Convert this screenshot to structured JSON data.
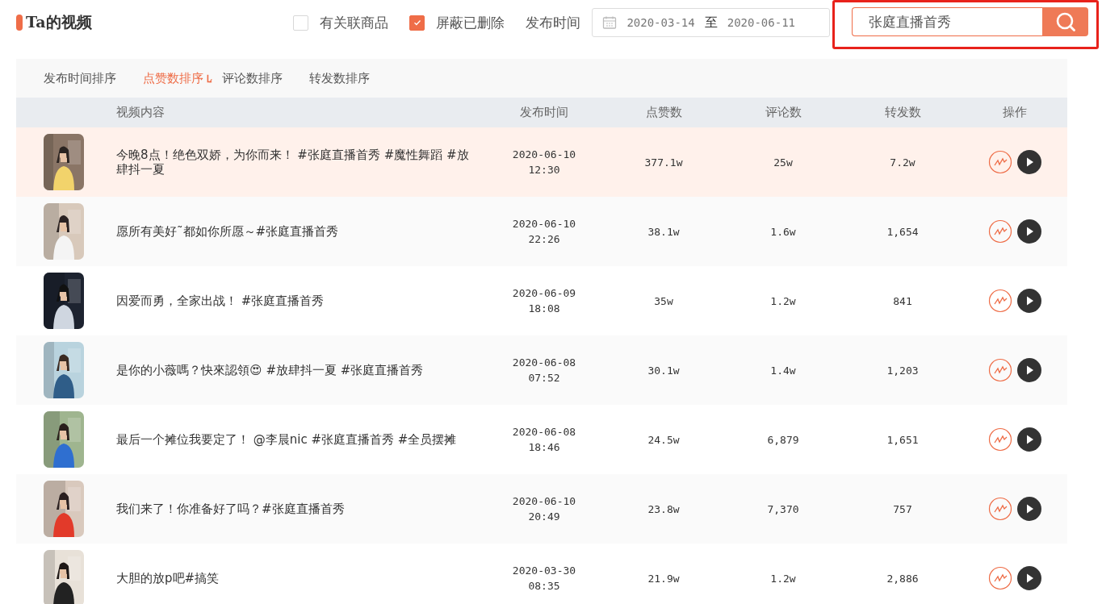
{
  "section": {
    "title": "Ta的视频"
  },
  "filters": [
    {
      "label": "有关联商品",
      "checked": false
    },
    {
      "label": "屏蔽已删除",
      "checked": true
    }
  ],
  "date_filter": {
    "label": "发布时间",
    "start": "2020-03-14",
    "separator": "至",
    "end": "2020-06-11"
  },
  "search": {
    "value": "张庭直播首秀"
  },
  "sort_tabs": [
    {
      "label": "发布时间排序",
      "selected": false
    },
    {
      "label": "点赞数排序",
      "selected": true
    },
    {
      "label": "评论数排序",
      "selected": false
    },
    {
      "label": "转发数排序",
      "selected": false
    }
  ],
  "table": {
    "columns": [
      "视频内容",
      "发布时间",
      "点赞数",
      "评论数",
      "转发数",
      "操作"
    ],
    "rows": [
      {
        "selected": true,
        "content": "今晚8点！绝色双娇，为你而来！ #张庭直播首秀 #魔性舞蹈 #放肆抖一夏",
        "date": "2020-06-10",
        "time": "12:30",
        "likes": "377.1w",
        "comments": "25w",
        "shares": "7.2w"
      },
      {
        "selected": false,
        "content": "愿所有美好˜都如你所愿～#张庭直播首秀",
        "date": "2020-06-10",
        "time": "22:26",
        "likes": "38.1w",
        "comments": "1.6w",
        "shares": "1,654"
      },
      {
        "selected": false,
        "content": "因爱而勇，全家出战！ #张庭直播首秀",
        "date": "2020-06-09",
        "time": "18:08",
        "likes": "35w",
        "comments": "1.2w",
        "shares": "841"
      },
      {
        "selected": false,
        "content": "是你的小薇嗎？快來認領😍 #放肆抖一夏 #张庭直播首秀",
        "date": "2020-06-08",
        "time": "07:52",
        "likes": "30.1w",
        "comments": "1.4w",
        "shares": "1,203"
      },
      {
        "selected": false,
        "content": "最后一个摊位我要定了！ @李晨nic #张庭直播首秀 #全员摆摊",
        "date": "2020-06-08",
        "time": "18:46",
        "likes": "24.5w",
        "comments": "6,879",
        "shares": "1,651"
      },
      {
        "selected": false,
        "content": "我们来了！你准备好了吗？#张庭直播首秀",
        "date": "2020-06-10",
        "time": "20:49",
        "likes": "23.8w",
        "comments": "7,370",
        "shares": "757"
      },
      {
        "selected": false,
        "content": "大胆的放p吧#搞笑",
        "date": "2020-03-30",
        "time": "08:35",
        "likes": "21.9w",
        "comments": "1.2w",
        "shares": "2,886"
      }
    ]
  }
}
